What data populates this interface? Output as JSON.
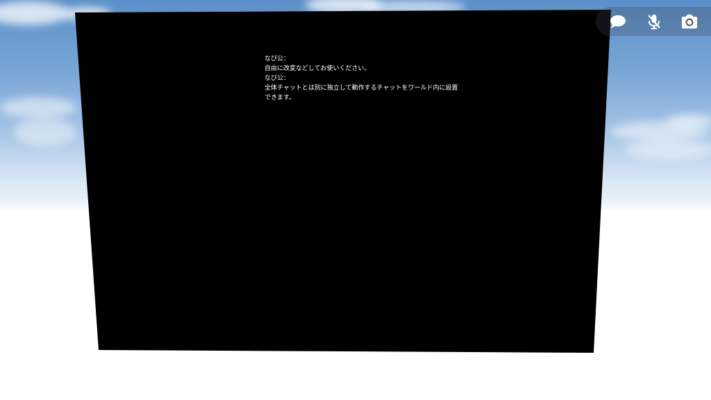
{
  "chat": {
    "lines": [
      "なび公：",
      "自由に改変などしてお使いください。",
      "なび公：",
      "全体チャットとは別に独立して動作するチャットをワールド内に設置",
      "できます。"
    ]
  },
  "hud": {
    "buttons": [
      "chat-bubble-icon",
      "mic-muted-icon",
      "camera-icon"
    ]
  },
  "colors": {
    "sky_top": "#5b8fc9",
    "sky_bottom": "#eef4fa",
    "ground": "#ffffff",
    "board": "#000000",
    "text": "#ffffff"
  }
}
